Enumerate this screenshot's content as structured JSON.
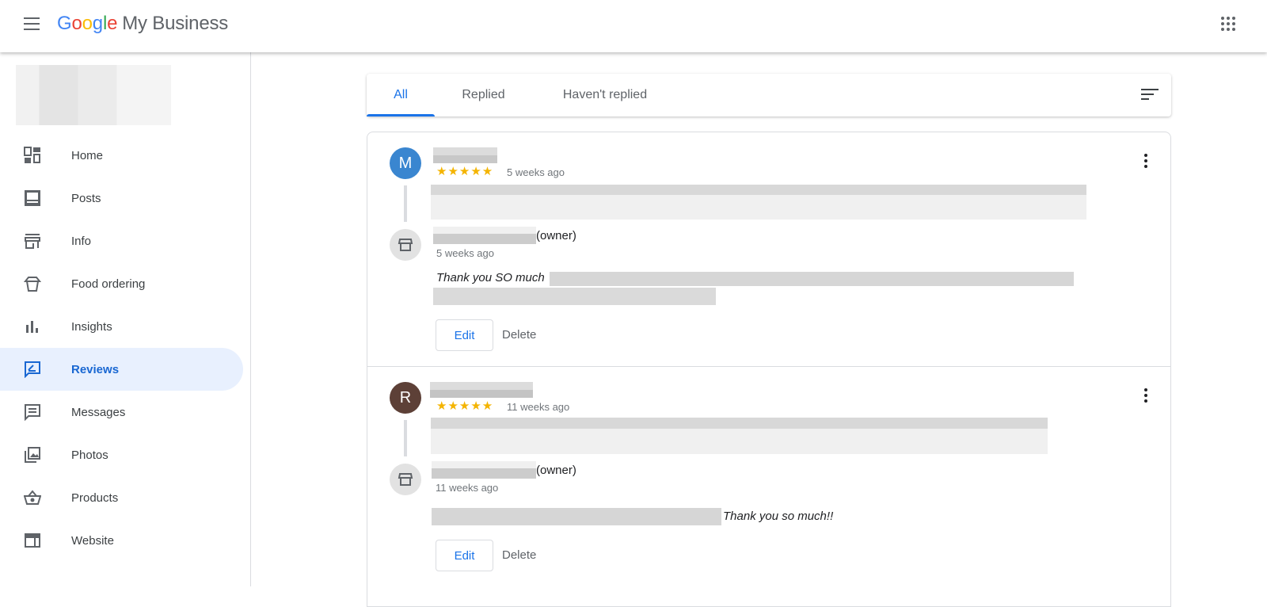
{
  "header": {
    "logo_google": "Google",
    "logo_product": "My Business"
  },
  "sidebar": {
    "items": [
      {
        "label": "Home",
        "icon": "dashboard-icon"
      },
      {
        "label": "Posts",
        "icon": "posts-icon"
      },
      {
        "label": "Info",
        "icon": "store-icon"
      },
      {
        "label": "Food ordering",
        "icon": "takeout-box-icon"
      },
      {
        "label": "Insights",
        "icon": "bar-chart-icon"
      },
      {
        "label": "Reviews",
        "icon": "rate-review-icon",
        "active": true
      },
      {
        "label": "Messages",
        "icon": "message-icon"
      },
      {
        "label": "Photos",
        "icon": "photo-library-icon"
      },
      {
        "label": "Products",
        "icon": "basket-icon"
      },
      {
        "label": "Website",
        "icon": "web-icon"
      }
    ]
  },
  "tabs": [
    "All",
    "Replied",
    "Haven't replied"
  ],
  "reviews": [
    {
      "initial": "M",
      "avatar_color": "#3a86d0",
      "stars": "★★★★★",
      "time": "5 weeks ago",
      "owner_label": "(owner)",
      "reply_time": "5 weeks ago",
      "reply_text": "Thank you SO much",
      "edit": "Edit",
      "delete": "Delete"
    },
    {
      "initial": "R",
      "avatar_color": "#5d4037",
      "stars": "★★★★★",
      "time": "11 weeks ago",
      "owner_label": "(owner)",
      "reply_time": "11 weeks ago",
      "reply_text": "Thank you so much!!",
      "edit": "Edit",
      "delete": "Delete"
    }
  ]
}
